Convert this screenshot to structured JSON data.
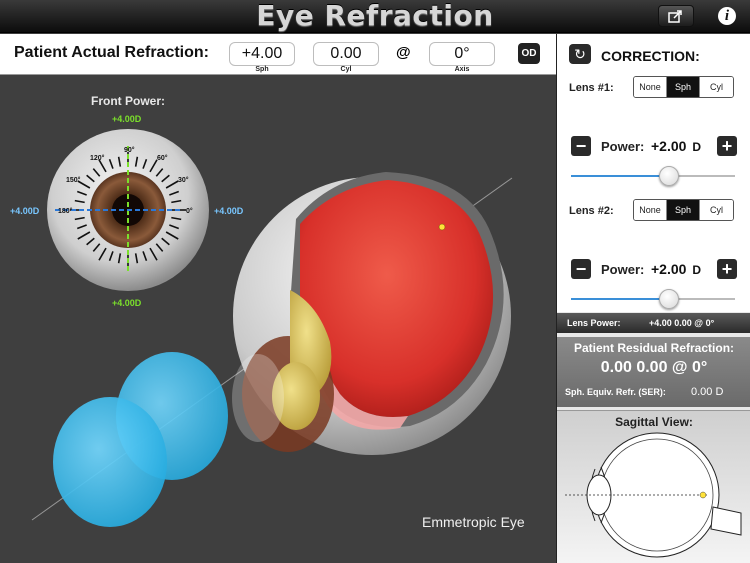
{
  "title": "Eye Refraction",
  "header": {
    "share_icon": "share-icon",
    "info_icon": "info-icon",
    "info_glyph": "i"
  },
  "refraction": {
    "label": "Patient Actual Refraction:",
    "sph": "+4.00",
    "sph_label": "Sph",
    "cyl": "0.00",
    "cyl_label": "Cyl",
    "at": "@",
    "axis": "0°",
    "axis_label": "Axis",
    "eye": "OD"
  },
  "front_power": {
    "title": "Front Power:",
    "top": "+4.00D",
    "bottom": "+4.00D",
    "left": "+4.00D",
    "right": "+4.00D",
    "degrees": [
      "180°",
      "150°",
      "120°",
      "90°",
      "60°",
      "30°",
      "0°"
    ]
  },
  "eye_caption": "Emmetropic Eye",
  "correction": {
    "title": "CORRECTION:",
    "lens1": {
      "label": "Lens #1:",
      "options": [
        "None",
        "Sph",
        "Cyl"
      ],
      "selected": "Sph",
      "power_label": "Power:",
      "power": "+2.00",
      "unit": "D",
      "slider_fraction": 0.6
    },
    "lens2": {
      "label": "Lens #2:",
      "options": [
        "None",
        "Sph",
        "Cyl"
      ],
      "selected": "Sph",
      "power_label": "Power:",
      "power": "+2.00",
      "unit": "D",
      "slider_fraction": 0.6
    },
    "minus": "−",
    "plus": "+"
  },
  "lens_power": {
    "label": "Lens Power:",
    "value": "+4.00 0.00 @ 0°"
  },
  "residual": {
    "title": "Patient Residual Refraction:",
    "value": "0.00 0.00 @ 0°",
    "ser_label": "Sph. Equiv. Refr. (SER):",
    "ser_value": "0.00 D"
  },
  "sagittal": {
    "title": "Sagittal View:"
  },
  "colors": {
    "accent_blue": "#3a8fd8",
    "meridian_green": "#7be02b",
    "meridian_blue": "#79c7ff",
    "retina_red": "#d8302a",
    "lens_cyan": "#2fb3e0"
  }
}
